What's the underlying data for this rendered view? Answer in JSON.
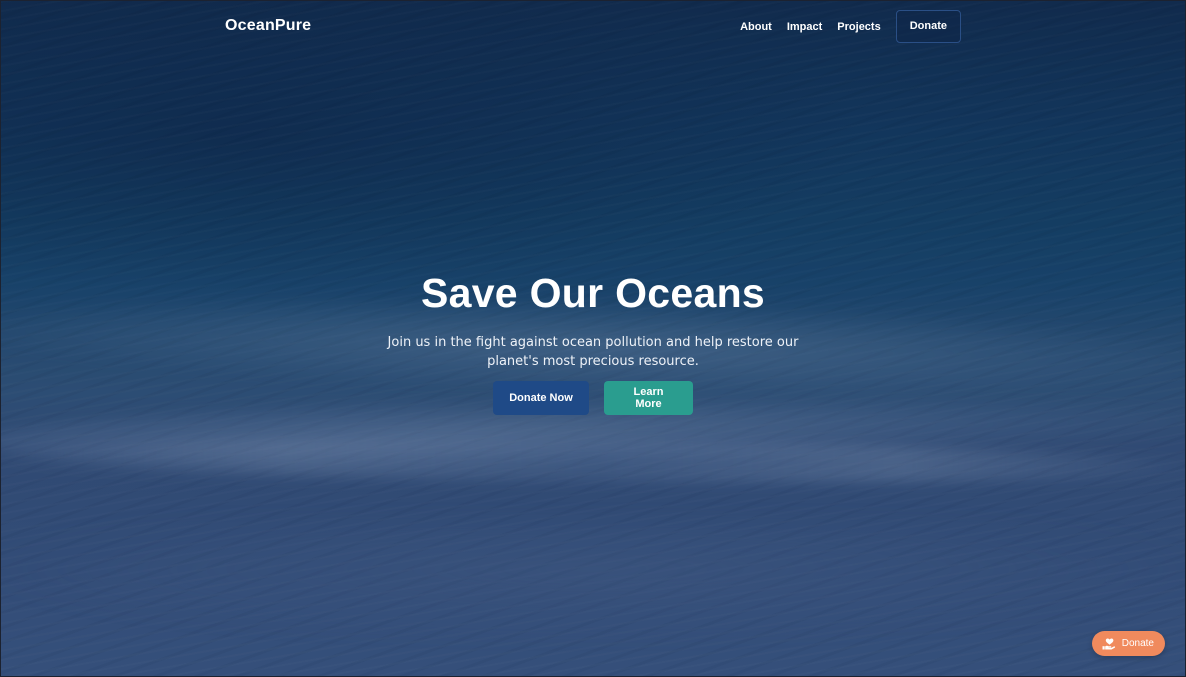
{
  "brand": {
    "name": "OceanPure"
  },
  "nav": {
    "links": [
      {
        "label": "About"
      },
      {
        "label": "Impact"
      },
      {
        "label": "Projects"
      }
    ],
    "donate_label": "Donate"
  },
  "hero": {
    "title": "Save Our Oceans",
    "subtitle": "Join us in the fight against ocean pollution and help restore our planet's most precious resource.",
    "primary_button": "Donate Now",
    "secondary_button": "Learn More"
  },
  "floating_donate": {
    "label": "Donate",
    "icon": "hand-holding-heart-icon"
  },
  "colors": {
    "primary": "#1f4a87",
    "secondary": "#2a9d8f",
    "accent": "#f08a5d"
  }
}
